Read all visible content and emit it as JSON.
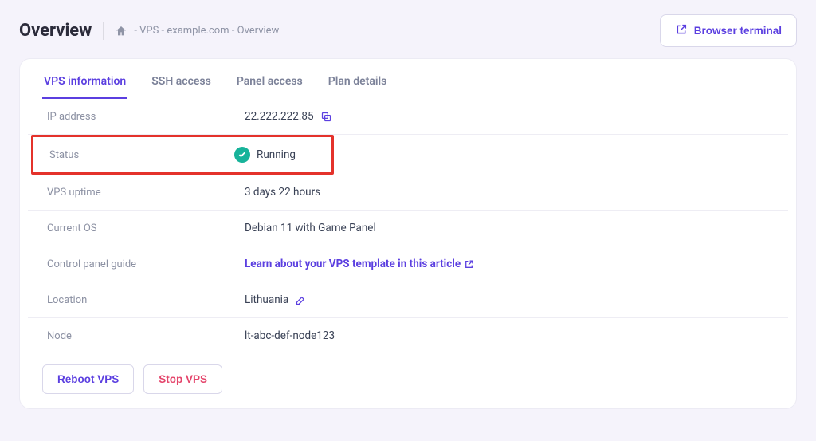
{
  "header": {
    "title": "Overview",
    "breadcrumb_text": "- VPS - example.com - Overview",
    "terminal_button": "Browser terminal"
  },
  "tabs": [
    {
      "label": "VPS information",
      "active": true
    },
    {
      "label": "SSH access",
      "active": false
    },
    {
      "label": "Panel access",
      "active": false
    },
    {
      "label": "Plan details",
      "active": false
    }
  ],
  "info": {
    "ip_label": "IP address",
    "ip_value": "22.222.222.85",
    "status_label": "Status",
    "status_value": "Running",
    "uptime_label": "VPS uptime",
    "uptime_value": "3 days 22 hours",
    "os_label": "Current OS",
    "os_value": "Debian 11 with Game Panel",
    "guide_label": "Control panel guide",
    "guide_value": "Learn about your VPS template in this article",
    "location_label": "Location",
    "location_value": "Lithuania",
    "node_label": "Node",
    "node_value": "lt-abc-def-node123"
  },
  "actions": {
    "reboot": "Reboot VPS",
    "stop": "Stop VPS"
  }
}
